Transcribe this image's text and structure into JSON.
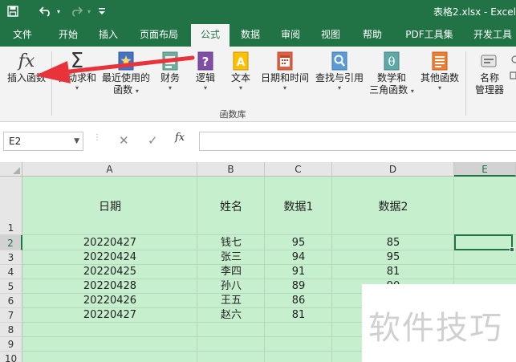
{
  "titlebar": {
    "file_title": "表格2.xlsx  -  Excel",
    "icons": [
      "save-icon",
      "undo-icon",
      "redo-icon",
      "customize-quick-access-icon"
    ]
  },
  "tabs": [
    "文件",
    "开始",
    "插入",
    "页面布局",
    "公式",
    "数据",
    "审阅",
    "视图",
    "帮助",
    "PDF工具集",
    "开发工具"
  ],
  "active_tab": "公式",
  "ribbon": {
    "insert_function": "插入函数",
    "autosum": "自动求和",
    "recent_line1": "最近使用的",
    "recent_line2": "函数",
    "financial": "财务",
    "logical": "逻辑",
    "text": "文本",
    "datetime": "日期和时间",
    "lookup": "查找与引用",
    "math_line1": "数学和",
    "math_line2": "三角函数",
    "other": "其他函数",
    "name_mgr_line1": "名称",
    "name_mgr_line2": "管理器",
    "group_label": "函数库",
    "dropdown_arrow": "▾"
  },
  "formula_bar": {
    "name_box": "E2",
    "cancel": "✕",
    "enter": "✓",
    "fx": "fx",
    "formula": ""
  },
  "sheet": {
    "columns": [
      "A",
      "B",
      "C",
      "D",
      "E"
    ],
    "rows": [
      "1",
      "2",
      "3",
      "4",
      "5",
      "6",
      "7",
      "8",
      "9",
      "10"
    ],
    "headers": [
      "日期",
      "姓名",
      "数据1",
      "数据2"
    ],
    "data": [
      [
        "20220427",
        "钱七",
        "95",
        "85"
      ],
      [
        "20220424",
        "张三",
        "94",
        "95"
      ],
      [
        "20220425",
        "李四",
        "91",
        "81"
      ],
      [
        "20220428",
        "孙八",
        "89",
        "90"
      ],
      [
        "20220426",
        "王五",
        "86",
        ""
      ],
      [
        "20220427",
        "赵六",
        "81",
        ""
      ]
    ]
  },
  "watermark": "软件技巧",
  "colors": {
    "excel_green": "#217346",
    "cell_fill": "#c6efce",
    "arrow_red": "#e8333a"
  }
}
